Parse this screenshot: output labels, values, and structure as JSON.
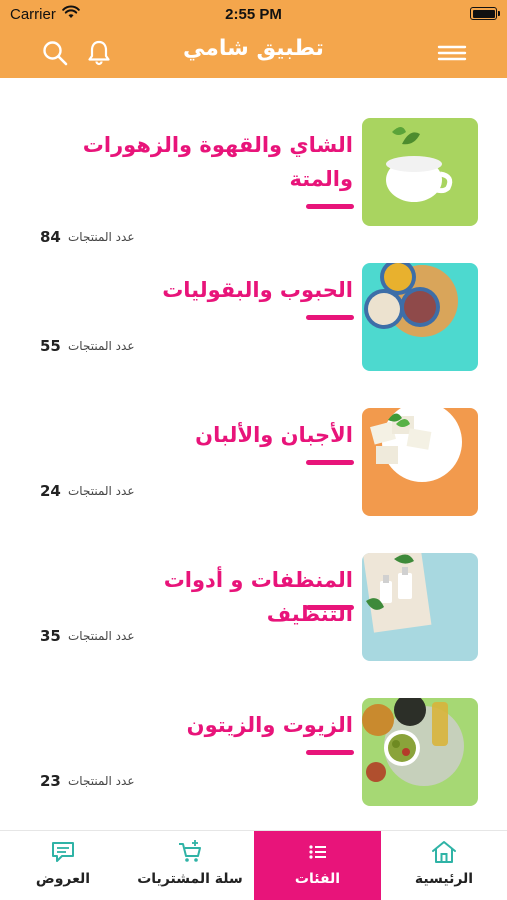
{
  "status": {
    "carrier": "Carrier",
    "time": "2:55 PM"
  },
  "header": {
    "title": "تطبيق شامي",
    "icons": [
      "search-icon",
      "bell-icon",
      "menu-icon"
    ],
    "background": "#f4a64c"
  },
  "categories": [
    {
      "name": "الشاي والقهوة والزهورات والمتة",
      "count_label": "عدد المنتجات",
      "count": "84",
      "thumb_bg": "#a9d460"
    },
    {
      "name": "الحبوب والبقوليات",
      "count_label": "عدد المنتجات",
      "count": "55",
      "thumb_bg": "#4dd9cf"
    },
    {
      "name": "الأجبان والألبان",
      "count_label": "عدد المنتجات",
      "count": "24",
      "thumb_bg": "#f29a4d"
    },
    {
      "name": "المنظفات و أدوات التنظيف",
      "count_label": "عدد المنتجات",
      "count": "35",
      "thumb_bg": "#a8d8e0"
    },
    {
      "name": "الزيوت والزيتون",
      "count_label": "عدد المنتجات",
      "count": "23",
      "thumb_bg": "#a6d874"
    }
  ],
  "tabs": [
    {
      "label": "العروض",
      "icon": "chat-icon",
      "active": false
    },
    {
      "label": "سلة المشتريات",
      "icon": "cart-icon",
      "active": false
    },
    {
      "label": "الفئات",
      "icon": "list-icon",
      "active": true
    },
    {
      "label": "الرئيسية",
      "icon": "home-icon",
      "active": false
    }
  ],
  "colors": {
    "accent": "#e8147a",
    "brand": "#f4a64c"
  }
}
